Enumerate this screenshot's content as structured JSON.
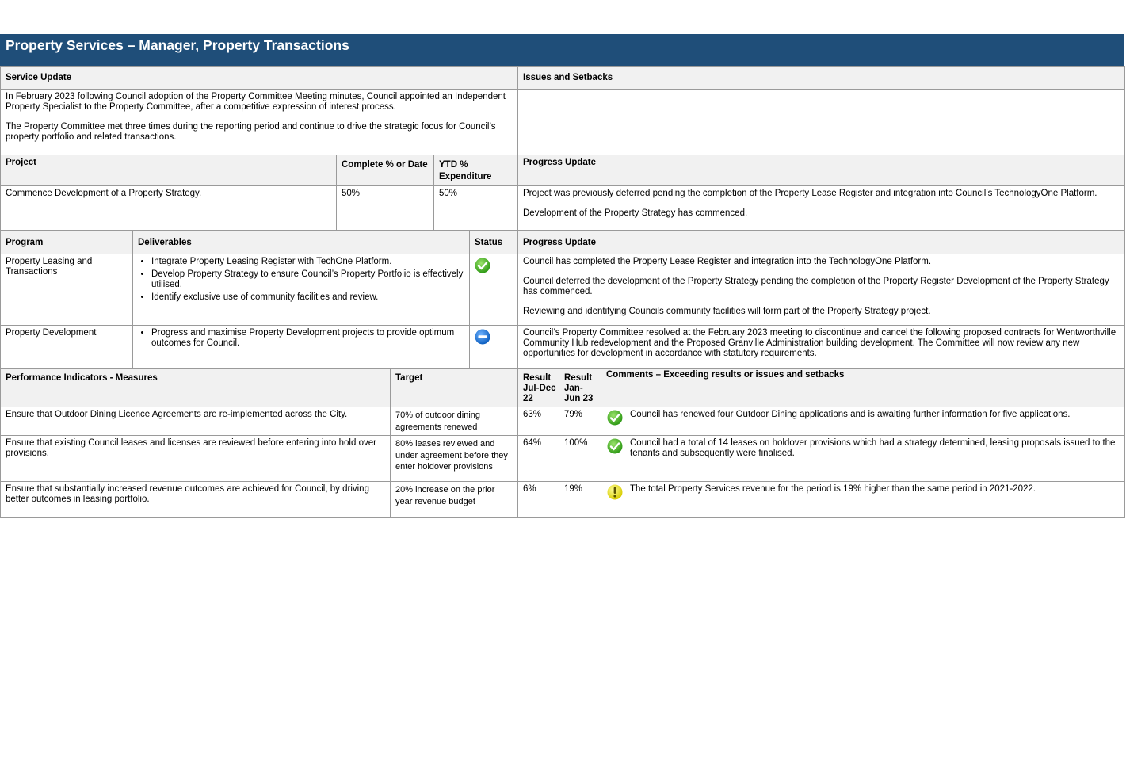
{
  "header": {
    "title": "Property Services – Manager, Property Transactions"
  },
  "service": {
    "update_heading": "Service Update",
    "issues_heading": "Issues and Setbacks",
    "update_paragraphs": [
      "In February 2023 following Council adoption of the Property Committee Meeting minutes, Council appointed an Independent Property Specialist to the Property Committee, after a competitive expression of interest process.",
      "The Property Committee met three times during the reporting period and continue to drive the strategic focus for Council’s property portfolio and related transactions."
    ],
    "issues_text": ""
  },
  "projects": {
    "headers": {
      "project": "Project",
      "complete": "Complete % or Date",
      "ytd": "YTD % Expenditure",
      "progress": "Progress Update"
    },
    "rows": [
      {
        "project": "Commence Development of a Property Strategy.",
        "complete": "50%",
        "ytd": "50%",
        "progress": [
          "Project was previously deferred  pending the completion of the Property Lease Register and integration into Council’s TechnologyOne Platform.",
          "Development of the Property Strategy has commenced."
        ]
      }
    ]
  },
  "programs": {
    "headers": {
      "program": "Program",
      "deliverables": "Deliverables",
      "status": "Status",
      "progress": "Progress Update"
    },
    "rows": [
      {
        "program": "Property Leasing and Transactions",
        "deliverables": [
          "Integrate Property Leasing Register with TechOne Platform.",
          "Develop Property    Strategy to ensure Council’s Property Portfolio is effectively utilised.",
          "Identify exclusive use of community facilities and review."
        ],
        "status_icon": "green-check-icon",
        "progress": [
          "Council has completed the Property Lease Register and integration into the TechnologyOne Platform.",
          "Council deferred the development of the Property Strategy pending the completion of the Property Register Development of the Property Strategy has commenced.",
          "Reviewing and identifying Councils community facilities will form part of the Property Strategy project."
        ]
      },
      {
        "program": "Property Development",
        "deliverables": [
          "Progress and maximise Property Development projects to provide optimum outcomes for Council."
        ],
        "status_icon": "blue-minus-icon",
        "progress": [
          "Council’s Property Committee resolved at the February 2023 meeting to discontinue and cancel the following proposed contracts for Wentworthville Community Hub redevelopment and the Proposed Granville Administration building development. The Committee will now review any new opportunities for development in accordance with statutory requirements."
        ]
      }
    ]
  },
  "kpis": {
    "headers": {
      "measure": "Performance Indicators - Measures",
      "target": "Target",
      "result1": "Result Jul-Dec 22",
      "result2": "Result Jan-Jun 23",
      "comments": "Comments – Exceeding results or issues and setbacks"
    },
    "rows": [
      {
        "measure": "Ensure that Outdoor Dining Licence Agreements are re-implemented across the City.",
        "target": "70% of outdoor dining agreements renewed",
        "result1": "63%",
        "result2": "79%",
        "status_icon": "green-check-icon",
        "comment": "Council has renewed four Outdoor Dining applications and is awaiting further information for five applications."
      },
      {
        "measure": "Ensure that existing Council leases and licenses are reviewed before entering into hold over provisions.",
        "target": "80% leases reviewed and under agreement before they enter holdover provisions",
        "result1": "64%",
        "result2": "100%",
        "status_icon": "green-check-icon",
        "comment": "Council had a total of 14 leases on holdover provisions which had a strategy determined, leasing proposals issued to the tenants and subsequently were finalised."
      },
      {
        "measure": "Ensure that substantially increased revenue outcomes are achieved for Council, by driving better outcomes in leasing portfolio.",
        "target": "20% increase on the prior year revenue budget",
        "result1": "6%",
        "result2": "19%",
        "status_icon": "yellow-exclamation-icon",
        "comment": "The total Property Services revenue for the period is 19% higher than the same period in 2021-2022."
      }
    ]
  },
  "colors": {
    "banner": "#1f4e79",
    "header_fill": "#f1f1f1",
    "status_green": "#3aa51f",
    "status_blue": "#1a73d4",
    "status_yellow": "#f2e600"
  }
}
